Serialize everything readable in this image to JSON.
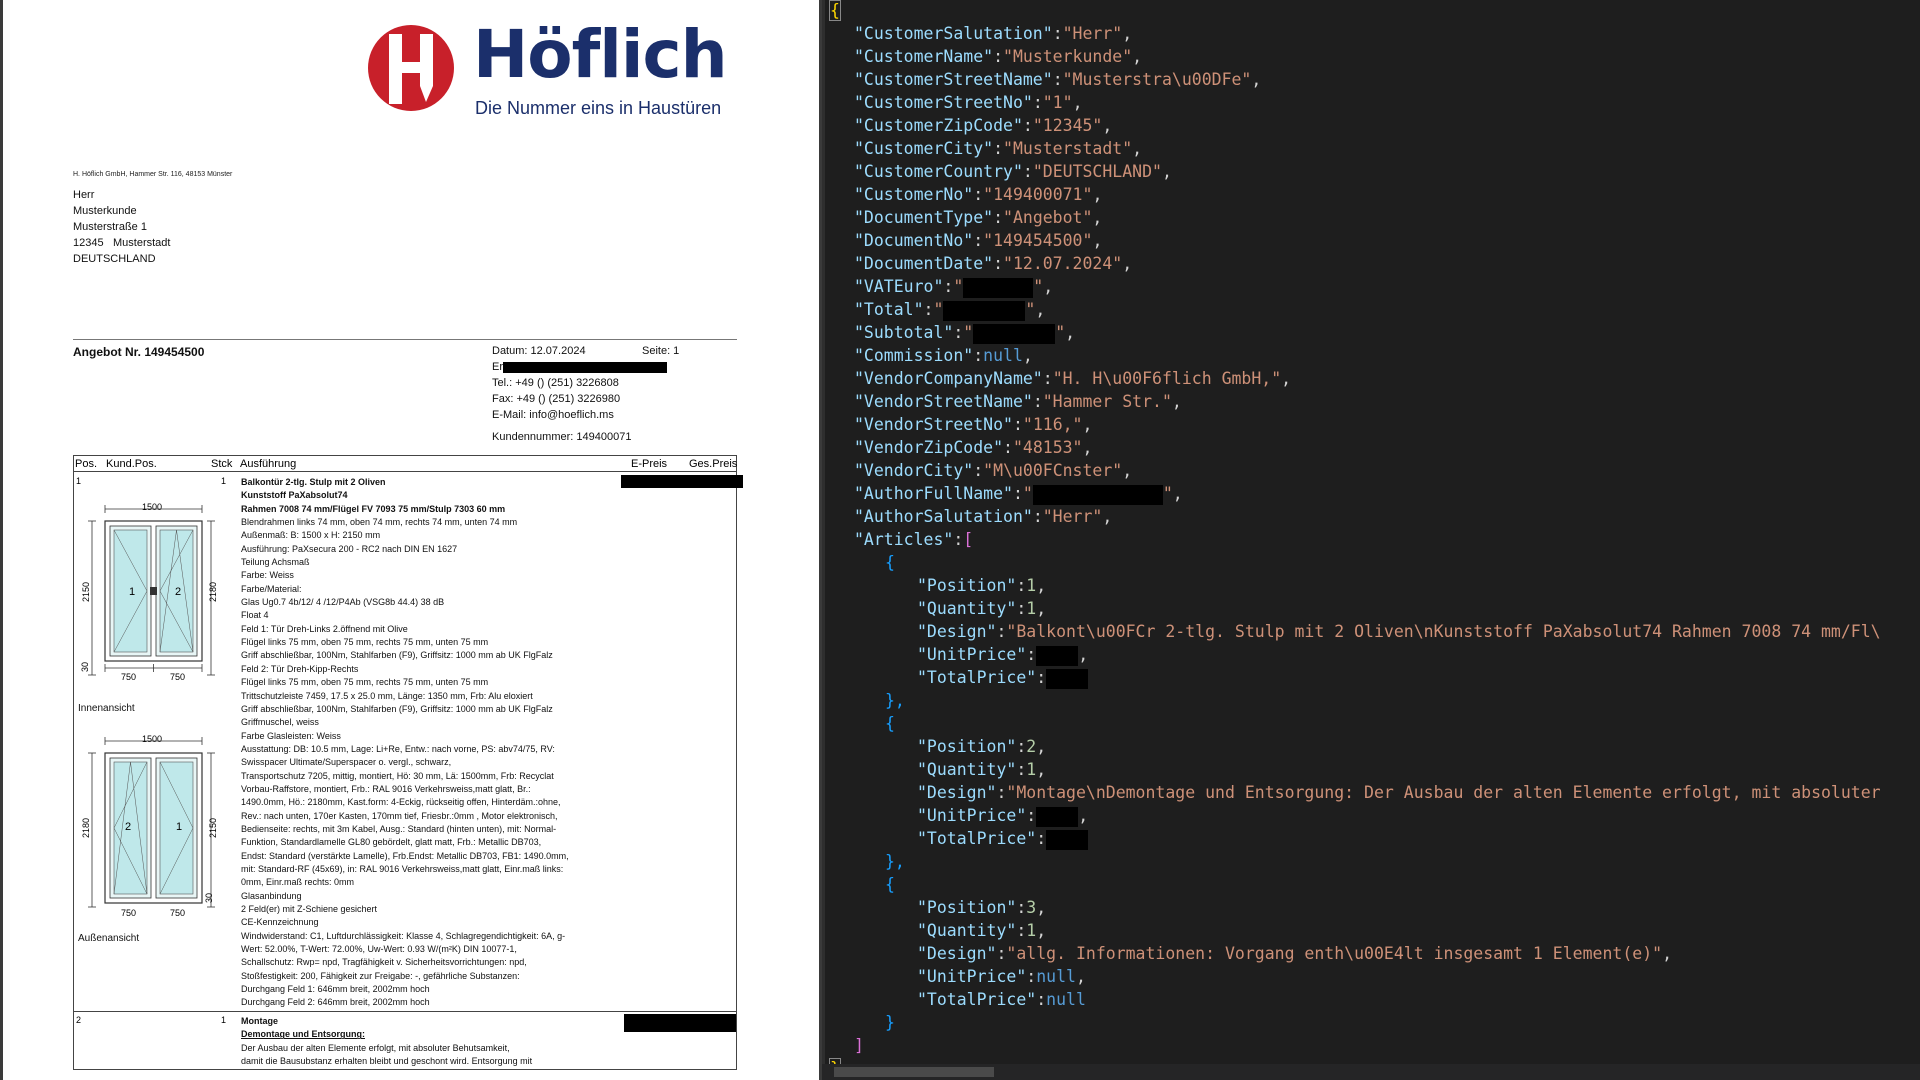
{
  "document": {
    "logo_word": "Höflich",
    "logo_tagline": "Die Nummer eins in Haustüren",
    "sender_line": "H. Höflich GmbH, Hammer Str. 116, 48153 Münster",
    "address": {
      "salutation": "Herr",
      "name": "Musterkunde",
      "street": "Musterstraße 1",
      "zip": "12345",
      "city": "Musterstadt",
      "country": "DEUTSCHLAND"
    },
    "title": "Angebot Nr. 149454500",
    "meta": {
      "date": "Datum: 12.07.2024",
      "page": "Seite: 1",
      "contact_prefix": "Er",
      "tel": "Tel.: +49 () (251) 3226808",
      "fax": "Fax: +49 () (251) 3226980",
      "email": "E-Mail: info@hoeflich.ms",
      "customer_no": "Kundennummer: 149400071"
    },
    "table_headers": {
      "pos": "Pos.",
      "kund_pos": "Kund.Pos.",
      "qty": "Stck",
      "desc": "Ausführung",
      "unit_price": "E-Preis",
      "total_price": "Ges.Preis"
    },
    "item1": {
      "pos": "1",
      "qty": "1",
      "inner_label": "Innenansicht",
      "outer_label": "Außenansicht",
      "dims": {
        "width": "1500",
        "height_left_inner": "2150",
        "height_right_inner": "2180",
        "sill_inner": "30",
        "half": "750",
        "height_left_outer": "2180",
        "height_right_outer": "2150",
        "sill_outer": "30",
        "sash_a": "1",
        "sash_b": "2"
      },
      "lines": [
        {
          "text": "Balkontür 2-tlg. Stulp mit 2 Oliven",
          "style": "b"
        },
        {
          "text": "Kunststoff PaXabsolut74",
          "style": "b"
        },
        {
          "text": "Rahmen 7008 74 mm/Flügel FV 7093 75 mm/Stulp 7303 60 mm",
          "style": "b"
        },
        {
          "text": "Blendrahmen links 74 mm, oben 74 mm, rechts 74 mm, unten 74 mm",
          "style": ""
        },
        {
          "text": "Außenmaß: B: 1500 x H: 2150 mm",
          "style": ""
        },
        {
          "text": "Ausführung: PaXsecura 200 - RC2 nach DIN EN 1627",
          "style": ""
        },
        {
          "text": "Teilung Achsmaß",
          "style": ""
        },
        {
          "text": "Farbe: Weiss",
          "style": ""
        },
        {
          "text": "Farbe/Material:",
          "style": ""
        },
        {
          "text": "Glas Ug0.7 4b/12/ 4 /12/P4Ab (VSG8b 44.4) 38 dB",
          "style": ""
        },
        {
          "text": "Float 4",
          "style": ""
        },
        {
          "text": "Feld 1: Tür Dreh-Links 2.öffnend mit Olive",
          "style": ""
        },
        {
          "text": "Flügel links 75 mm, oben 75 mm, rechts 75 mm, unten 75 mm",
          "style": ""
        },
        {
          "text": "Griff abschließbar, 100Nm, Stahlfarben (F9), Griffsitz: 1000 mm ab UK FlgFalz",
          "style": ""
        },
        {
          "text": "Feld 2: Tür Dreh-Kipp-Rechts",
          "style": ""
        },
        {
          "text": "Flügel links 75 mm, oben 75 mm, rechts 75 mm, unten 75 mm",
          "style": ""
        },
        {
          "text": "Trittschutzleiste 7459, 17.5 x 25.0 mm, Länge: 1350 mm, Frb: Alu eloxiert",
          "style": ""
        },
        {
          "text": "Griff abschließbar, 100Nm, Stahlfarben (F9), Griffsitz: 1000 mm ab UK FlgFalz",
          "style": ""
        },
        {
          "text": "Griffmuschel, weiss",
          "style": ""
        },
        {
          "text": "Farbe Glasleisten: Weiss",
          "style": ""
        },
        {
          "text": "Ausstattung: DB: 10.5 mm, Lage: Li+Re, Entw.: nach vorne, PS: abv74/75, RV:",
          "style": ""
        },
        {
          "text": "Swisspacer Ultimate/Superspacer o. vergl., schwarz,",
          "style": ""
        },
        {
          "text": "Transportschutz 7205, mittig, montiert, Hö: 30 mm, Lä: 1500mm, Frb: Recyclat",
          "style": ""
        },
        {
          "text": "Vorbau-Raffstore, montiert, Frb.: RAL 9016 Verkehrsweiss,matt glatt, Br.:",
          "style": ""
        },
        {
          "text": "1490.0mm, Hö.: 2180mm, Kast.form: 4-Eckig, rückseitig offen, Hinterdäm.:ohne,",
          "style": ""
        },
        {
          "text": "Rev.: nach unten, 170er Kasten, 170mm tief, Friesbr.:0mm , Motor elektronisch,",
          "style": ""
        },
        {
          "text": "Bedienseite: rechts, mit 3m Kabel, Ausg.: Standard (hinten unten), mit: Normal-",
          "style": ""
        },
        {
          "text": "Funktion, Standardlamelle GL80 gebördelt, glatt matt, Frb.: Metallic DB703,",
          "style": ""
        },
        {
          "text": "Endst: Standard (verstärkte Lamelle), Frb.Endst: Metallic DB703, FB1: 1490.0mm,",
          "style": ""
        },
        {
          "text": "mit: Standard-RF (45x69), in: RAL 9016 Verkehrsweiss,matt glatt, Einr.maß links:",
          "style": ""
        },
        {
          "text": "0mm, Einr.maß rechts: 0mm",
          "style": ""
        },
        {
          "text": "Glasanbindung",
          "style": ""
        },
        {
          "text": "2 Feld(er) mit Z-Schiene gesichert",
          "style": ""
        },
        {
          "text": "CE-Kennzeichnung",
          "style": ""
        },
        {
          "text": "Windwiderstand: C1,  Luftdurchlässigkeit: Klasse 4, Schlagregendichtigkeit: 6A,  g-",
          "style": ""
        },
        {
          "text": "Wert: 52.00%,  T-Wert: 72.00%, Uw-Wert: 0.93 W/(m²K) DIN 10077-1,",
          "style": ""
        },
        {
          "text": "Schallschutz: Rwp= npd, Tragfähigkeit v. Sicherheitsvorrichtungen: npd,",
          "style": ""
        },
        {
          "text": "Stoßfestigkeit: 200, Fähigkeit zur Freigabe: -,  gefährliche Substanzen:",
          "style": ""
        },
        {
          "text": "Durchgang Feld 1: 646mm breit, 2002mm hoch",
          "style": ""
        },
        {
          "text": "Durchgang Feld 2: 646mm breit, 2002mm hoch",
          "style": ""
        }
      ]
    },
    "item2": {
      "pos": "2",
      "qty": "1",
      "lines": [
        {
          "text": "Montage",
          "style": "b"
        },
        {
          "text": "Demontage und Entsorgung:",
          "style": "u"
        },
        {
          "text": "Der Ausbau der alten Elemente erfolgt, mit absoluter Behutsamkeit,",
          "style": ""
        },
        {
          "text": "damit die Bausubstanz erhalten bleibt und geschont wird. Entsorgung mit",
          "style": ""
        }
      ]
    }
  },
  "editor": {
    "open_brace": "{",
    "fields": [
      {
        "key": "CustomerSalutation",
        "value": "Herr"
      },
      {
        "key": "CustomerName",
        "value": "Musterkunde"
      },
      {
        "key": "CustomerStreetName",
        "value": "Musterstra\\u00DFe"
      },
      {
        "key": "CustomerStreetNo",
        "value": "1"
      },
      {
        "key": "CustomerZipCode",
        "value": "12345"
      },
      {
        "key": "CustomerCity",
        "value": "Musterstadt"
      },
      {
        "key": "CustomerCountry",
        "value": "DEUTSCHLAND"
      },
      {
        "key": "CustomerNo",
        "value": "149400071"
      },
      {
        "key": "DocumentType",
        "value": "Angebot"
      },
      {
        "key": "DocumentNo",
        "value": "149454500"
      },
      {
        "key": "DocumentDate",
        "value": "12.07.2024"
      }
    ],
    "redacted_keys": [
      "VATEuro",
      "Total",
      "Subtotal"
    ],
    "commission_key": "Commission",
    "null_literal": "null",
    "vendor_fields": [
      {
        "key": "VendorCompanyName",
        "value": "H. H\\u00F6flich GmbH,"
      },
      {
        "key": "VendorStreetName",
        "value": "Hammer Str."
      },
      {
        "key": "VendorStreetNo",
        "value": "116,"
      },
      {
        "key": "VendorZipCode",
        "value": "48153"
      },
      {
        "key": "VendorCity",
        "value": "M\\u00FCnster"
      }
    ],
    "author_full_name_key": "AuthorFullName",
    "author_salutation": {
      "key": "AuthorSalutation",
      "value": "Herr"
    },
    "articles_key": "Articles",
    "articles": [
      {
        "position": "1",
        "quantity": "1",
        "design": "Balkont\\u00FCr 2-tlg. Stulp mit 2 Oliven\\nKunststoff PaXabsolut74 Rahmen 7008 74 mm/Fl\\",
        "unit_redacted": true
      },
      {
        "position": "2",
        "quantity": "1",
        "design": "Montage\\nDemontage und Entsorgung: Der Ausbau der alten Elemente erfolgt, mit absoluter",
        "unit_redacted": true
      },
      {
        "position": "3",
        "quantity": "1",
        "design": "allg. Informationen: Vorgang enth\\u00E4lt insgesamt 1 Element(e)",
        "unit_redacted": false
      }
    ],
    "k_position": "Position",
    "k_quantity": "Quantity",
    "k_design": "Design",
    "k_unit": "UnitPrice",
    "k_total": "TotalPrice",
    "close_bracket": "]",
    "close_brace": "}"
  },
  "colors": {
    "logo_red": "#c8202a",
    "logo_blue": "#1b2f6b",
    "editor_bg": "#1e1e1e",
    "json_key": "#9cdcfe",
    "json_string": "#ce9178",
    "json_number": "#b5cea8",
    "json_null": "#569cd6"
  }
}
